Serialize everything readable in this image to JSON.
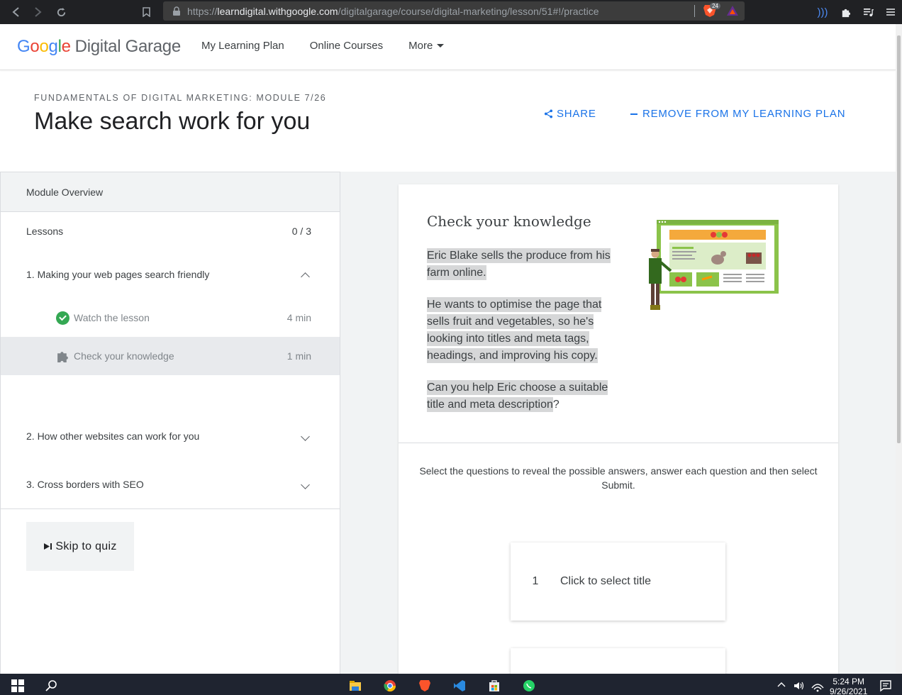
{
  "browser": {
    "url_prefix": "https://",
    "url_host": "learndigital.withgoogle.com",
    "url_path": "/digitalgarage/course/digital-marketing/lesson/51#!/practice",
    "brave_count": "24"
  },
  "header": {
    "logo_g1": "G",
    "logo_g2": "o",
    "logo_g3": "o",
    "logo_g4": "g",
    "logo_g5": "l",
    "logo_g6": "e",
    "logo_suffix": "Digital Garage",
    "nav": [
      "My Learning Plan",
      "Online Courses",
      "More"
    ]
  },
  "course": {
    "eyebrow": "FUNDAMENTALS OF DIGITAL MARKETING: MODULE 7/26",
    "title": "Make search work for you",
    "share_label": "SHARE",
    "remove_label": "REMOVE FROM MY LEARNING PLAN"
  },
  "sidebar": {
    "overview": "Module Overview",
    "lessons_label": "Lessons",
    "lessons_count": "0 / 3",
    "sections": [
      {
        "title": "1. Making your web pages search friendly",
        "items": [
          {
            "label": "Watch the lesson",
            "duration": "4 min"
          },
          {
            "label": "Check your knowledge",
            "duration": "1 min"
          }
        ]
      },
      {
        "title": "2. How other websites can work for you"
      },
      {
        "title": "3. Cross borders with SEO"
      }
    ],
    "skip_label": "Skip to quiz"
  },
  "card": {
    "title": "Check your knowledge",
    "paragraphs": [
      "Eric Blake sells the produce from his farm online.",
      "He wants to optimise the page that sells fruit and vegetables, so he's looking into titles and meta tags, headings, and improving his copy.",
      "Can you help Eric choose a suitable title and meta description"
    ],
    "p3_tail": "?",
    "instructions": "Select the questions to reveal the possible answers, answer each question and then select Submit.",
    "questions": [
      {
        "number": "1",
        "label": "Click to select title"
      }
    ]
  },
  "taskbar": {
    "time": "5:24 PM",
    "date": "9/26/2021"
  },
  "colors": {
    "accent": "#1a73e8",
    "success": "#34a853",
    "highlight": "#d6d7d8"
  }
}
